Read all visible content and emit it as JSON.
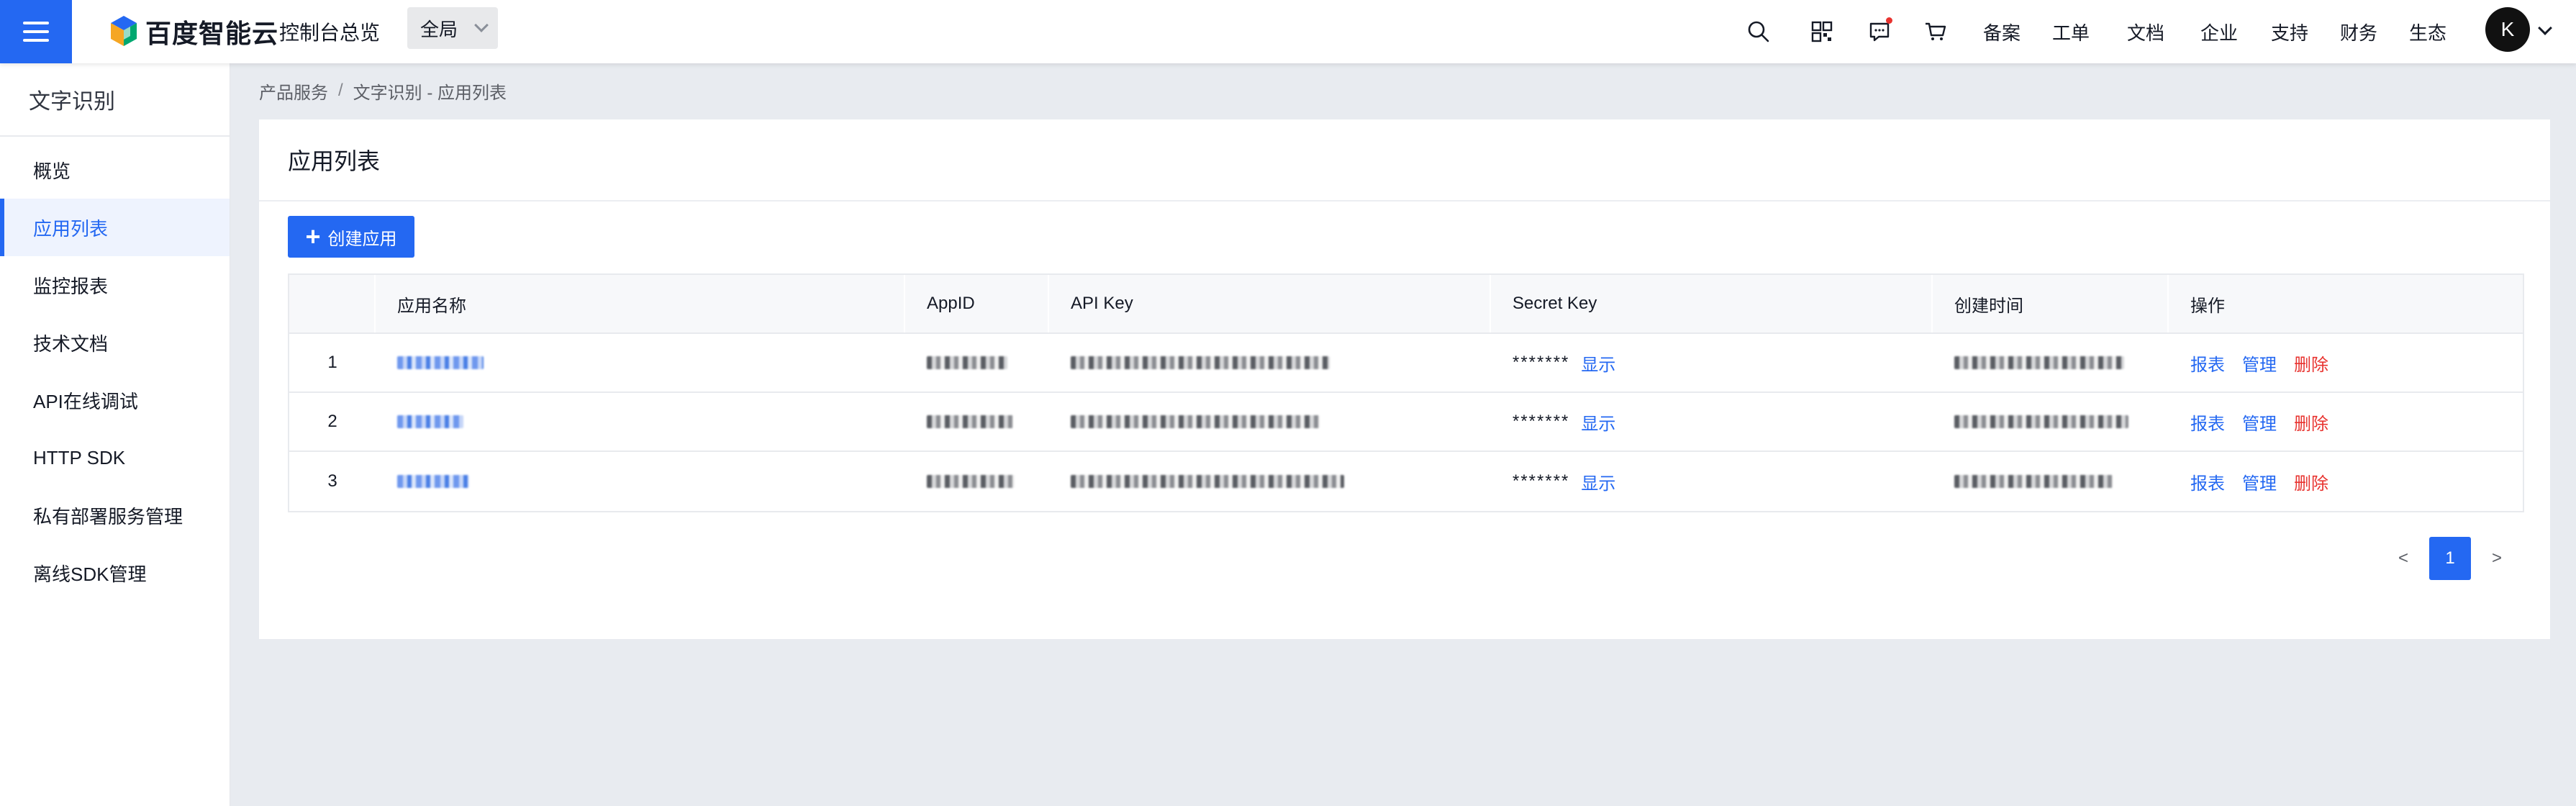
{
  "topbar": {
    "brand": "百度智能云",
    "console_title": "控制台总览",
    "region": "全局",
    "nav": [
      "备案",
      "工单",
      "文档",
      "企业",
      "支持",
      "财务",
      "生态"
    ],
    "avatar_letter": "K",
    "icons": [
      "search-icon",
      "qrcode-icon",
      "message-icon",
      "cart-icon"
    ]
  },
  "sidebar": {
    "title": "文字识别",
    "items": [
      {
        "label": "概览"
      },
      {
        "label": "应用列表"
      },
      {
        "label": "监控报表"
      },
      {
        "label": "技术文档"
      },
      {
        "label": "API在线调试"
      },
      {
        "label": "HTTP SDK"
      },
      {
        "label": "私有部署服务管理"
      },
      {
        "label": "离线SDK管理"
      }
    ],
    "active_index": 1
  },
  "breadcrumb": {
    "root": "产品服务",
    "separator": "/",
    "current": "文字识别 - 应用列表"
  },
  "panel": {
    "title": "应用列表",
    "create_button": "创建应用"
  },
  "table": {
    "headers": [
      "",
      "应用名称",
      "AppID",
      "API Key",
      "Secret Key",
      "创建时间",
      "操作"
    ],
    "rows": [
      {
        "index": "1",
        "secret_mask": "*******",
        "show": "显示",
        "actions": [
          "报表",
          "管理",
          "删除"
        ]
      },
      {
        "index": "2",
        "secret_mask": "*******",
        "show": "显示",
        "actions": [
          "报表",
          "管理",
          "删除"
        ]
      },
      {
        "index": "3",
        "secret_mask": "*******",
        "show": "显示",
        "actions": [
          "报表",
          "管理",
          "删除"
        ]
      }
    ]
  },
  "pagination": {
    "prev": "<",
    "current": "1",
    "next": ">"
  },
  "colors": {
    "accent": "#2468f2",
    "danger": "#e8332f",
    "background": "#e8ebf0"
  }
}
